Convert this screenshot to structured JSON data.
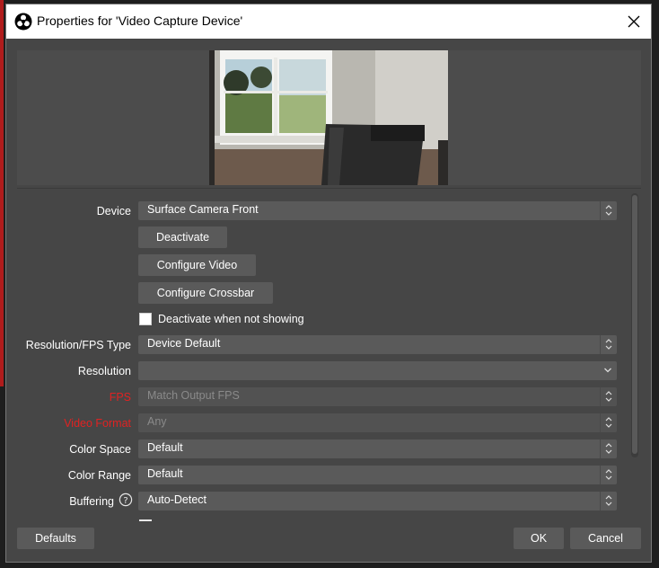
{
  "window": {
    "title": "Properties for 'Video Capture Device'",
    "app_icon": "obs-icon",
    "close_icon": "close-icon"
  },
  "preview": {
    "description_icon": "camera-preview-image"
  },
  "properties": {
    "device": {
      "label": "Device",
      "value": "Surface Camera Front"
    },
    "buttons": {
      "deactivate": "Deactivate",
      "configure_video": "Configure Video",
      "configure_crossbar": "Configure Crossbar"
    },
    "deactivate_when_not_showing": {
      "label": "Deactivate when not showing",
      "checked": false
    },
    "resolution_fps_type": {
      "label": "Resolution/FPS Type",
      "value": "Device Default"
    },
    "resolution": {
      "label": "Resolution",
      "value": ""
    },
    "fps": {
      "label": "FPS",
      "value": "Match Output FPS"
    },
    "video_format": {
      "label": "Video Format",
      "value": "Any"
    },
    "color_space": {
      "label": "Color Space",
      "value": "Default"
    },
    "color_range": {
      "label": "Color Range",
      "value": "Default"
    },
    "buffering": {
      "label": "Buffering",
      "value": "Auto-Detect"
    }
  },
  "footer": {
    "defaults": "Defaults",
    "ok": "OK",
    "cancel": "Cancel"
  },
  "colors": {
    "dialog_bg": "#464646",
    "field_bg": "#5a5a5a",
    "warning_label": "#e02222"
  }
}
